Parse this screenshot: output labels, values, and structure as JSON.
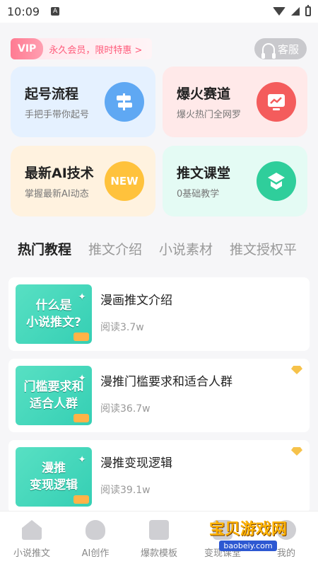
{
  "status_bar": {
    "time": "10:09",
    "notif_letter": "A"
  },
  "header": {
    "vip_label": "VIP",
    "vip_text": "永久会员，限时特惠 >",
    "service_label": "客服"
  },
  "cards": [
    {
      "title": "起号流程",
      "subtitle": "手把手带你起号",
      "icon": "signpost-icon"
    },
    {
      "title": "爆火赛道",
      "subtitle": "爆火热门全网罗",
      "icon": "trend-chart-icon"
    },
    {
      "title": "最新AI技术",
      "subtitle": "掌握最新AI动态",
      "icon": "new-badge-icon",
      "badge_text": "NEW"
    },
    {
      "title": "推文课堂",
      "subtitle": "0基础教学",
      "icon": "course-icon"
    }
  ],
  "tabs": [
    "热门教程",
    "推文介绍",
    "小说素材",
    "推文授权平"
  ],
  "list": [
    {
      "title": "漫画推文介绍",
      "reads": "阅读3.7w",
      "thumb_lines": [
        "什么是",
        "小说推文?"
      ],
      "vip": false
    },
    {
      "title": "漫推门槛要求和适合人群",
      "reads": "阅读36.7w",
      "thumb_lines": [
        "门槛要求和",
        "适合人群"
      ],
      "vip": true
    },
    {
      "title": "漫推变现逻辑",
      "reads": "阅读39.1w",
      "thumb_lines": [
        "漫推",
        "变现逻辑"
      ],
      "vip": true
    }
  ],
  "bottom_nav": [
    "小说推文",
    "AI创作",
    "爆款模板",
    "变现课堂",
    "我的"
  ],
  "watermark": {
    "main": "宝贝游戏网",
    "url": "baobeiy.com"
  },
  "colors": {
    "vip": "#ff7b92",
    "accent_green": "#2fce9b",
    "diamond": "#f6c24a"
  }
}
